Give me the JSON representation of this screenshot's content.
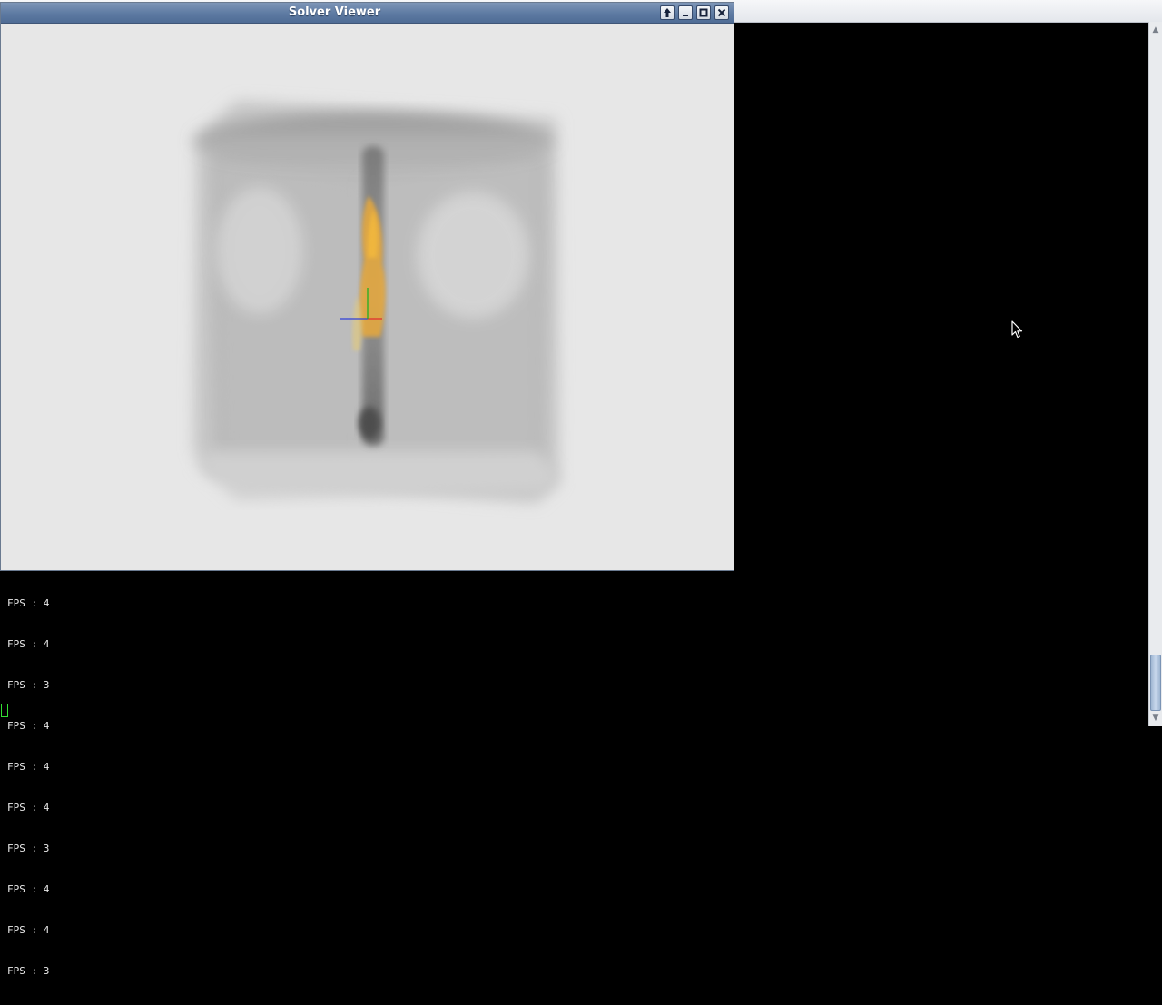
{
  "terminal": {
    "lines": [
      "FPS : 4",
      "FPS : 4",
      "FPS : 3",
      "FPS : 4",
      "FPS : 4",
      "FPS : 4",
      "FPS : 3",
      "FPS : 4",
      "FPS : 4",
      "FPS : 3"
    ]
  },
  "viewer": {
    "title": "Solver Viewer",
    "buttons": {
      "raise": "🡡",
      "minimize": "_",
      "maximize": "□",
      "close": "✕"
    }
  },
  "scene": {
    "axes_colors": {
      "x": "#e03030",
      "y": "#22b022",
      "z": "#2f3fd8"
    },
    "flame_color": "#e8a93a",
    "smoke_color": "#555555"
  }
}
